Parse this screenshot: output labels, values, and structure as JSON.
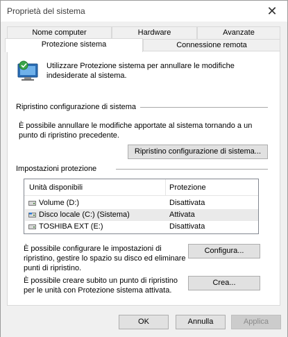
{
  "window": {
    "title": "Proprietà del sistema",
    "close_symbol": "✕"
  },
  "tabs": {
    "row1": [
      {
        "label": "Nome computer"
      },
      {
        "label": "Hardware"
      },
      {
        "label": "Avanzate"
      }
    ],
    "row2": [
      {
        "label": "Protezione sistema",
        "active": true
      },
      {
        "label": "Connessione remota"
      }
    ]
  },
  "intro": {
    "icon": "system-protection-icon",
    "text": "Utilizzare Protezione sistema per annullare le modifiche indesiderate al sistema."
  },
  "restore": {
    "group_title": "Ripristino configurazione di sistema",
    "description": "È possibile annullare le modifiche apportate al sistema tornando a un punto di ripristino precedente.",
    "button_label": "Ripristino configurazione di sistema..."
  },
  "protection": {
    "group_title": "Impostazioni protezione",
    "columns": [
      "Unità disponibili",
      "Protezione"
    ],
    "drives": [
      {
        "name": "Volume (D:)",
        "status": "Disattivata",
        "icon": "drive-icon",
        "selected": false
      },
      {
        "name": "Disco locale (C:) (Sistema)",
        "status": "Attivata",
        "icon": "system-drive-icon",
        "selected": true
      },
      {
        "name": "TOSHIBA EXT (E:)",
        "status": "Disattivata",
        "icon": "drive-icon",
        "selected": false
      }
    ],
    "configure_text": "È possibile configurare le impostazioni di ripristino, gestire lo spazio su disco ed eliminare punti di ripristino.",
    "configure_button": "Configura...",
    "create_text": "È possibile creare subito un punto di ripristino per le unità con Protezione sistema attivata.",
    "create_button": "Crea..."
  },
  "footer": {
    "ok": "OK",
    "cancel": "Annulla",
    "apply": "Applica"
  },
  "colors": {
    "selected_row": "#eaeaea",
    "button_bg": "#e1e1e1",
    "window_bg": "#f0f0f0"
  }
}
